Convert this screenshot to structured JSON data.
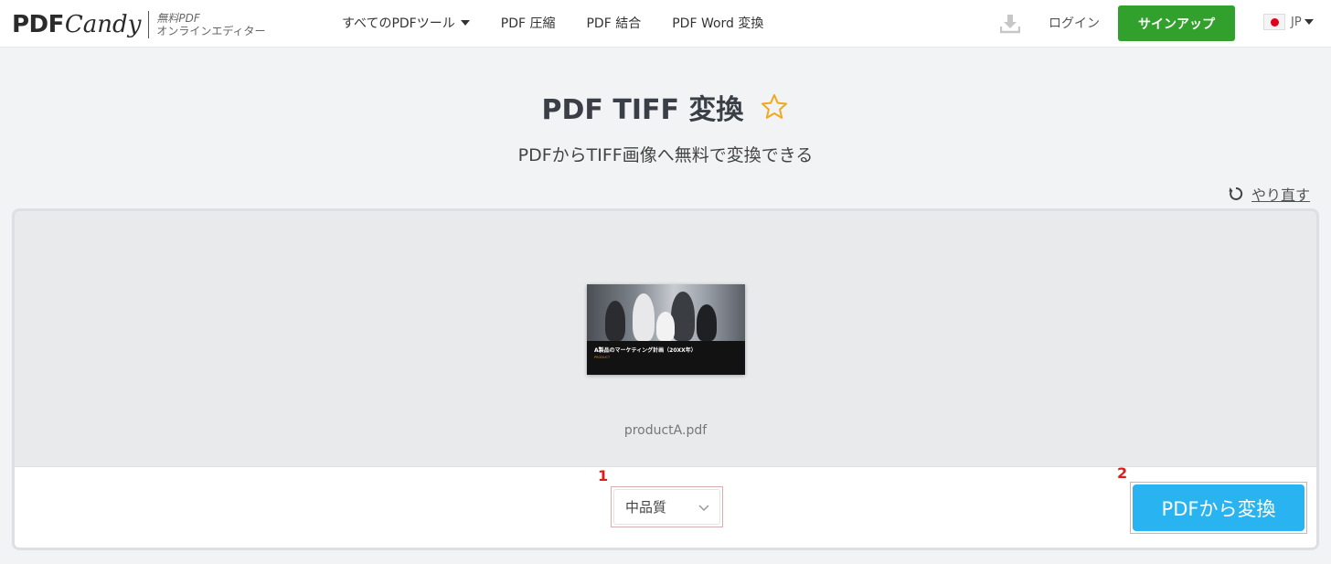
{
  "header": {
    "logo_pdf": "PDF",
    "logo_candy": "Candy",
    "logo_tag_line1": "無料PDF",
    "logo_tag_line2": "オンラインエディター",
    "nav": [
      "すべてのPDFツール",
      "PDF 圧縮",
      "PDF 結合",
      "PDF Word 変換"
    ],
    "login": "ログイン",
    "signup": "サインアップ",
    "lang": "JP"
  },
  "main": {
    "title": "PDF TIFF 変換",
    "subtitle": "PDFからTIFF画像へ無料で変換できる",
    "redo": "やり直す"
  },
  "file": {
    "name": "productA.pdf",
    "thumb_title": "A製品のマーケティング計画（20XX年）",
    "thumb_sub": "PRODUCT"
  },
  "controls": {
    "quality": "中品質",
    "convert": "PDFから変換",
    "marker1": "1",
    "marker2": "2"
  },
  "colors": {
    "accent_green": "#32a02c",
    "accent_blue": "#29b3f0",
    "annotation_red": "#e01b1b"
  }
}
